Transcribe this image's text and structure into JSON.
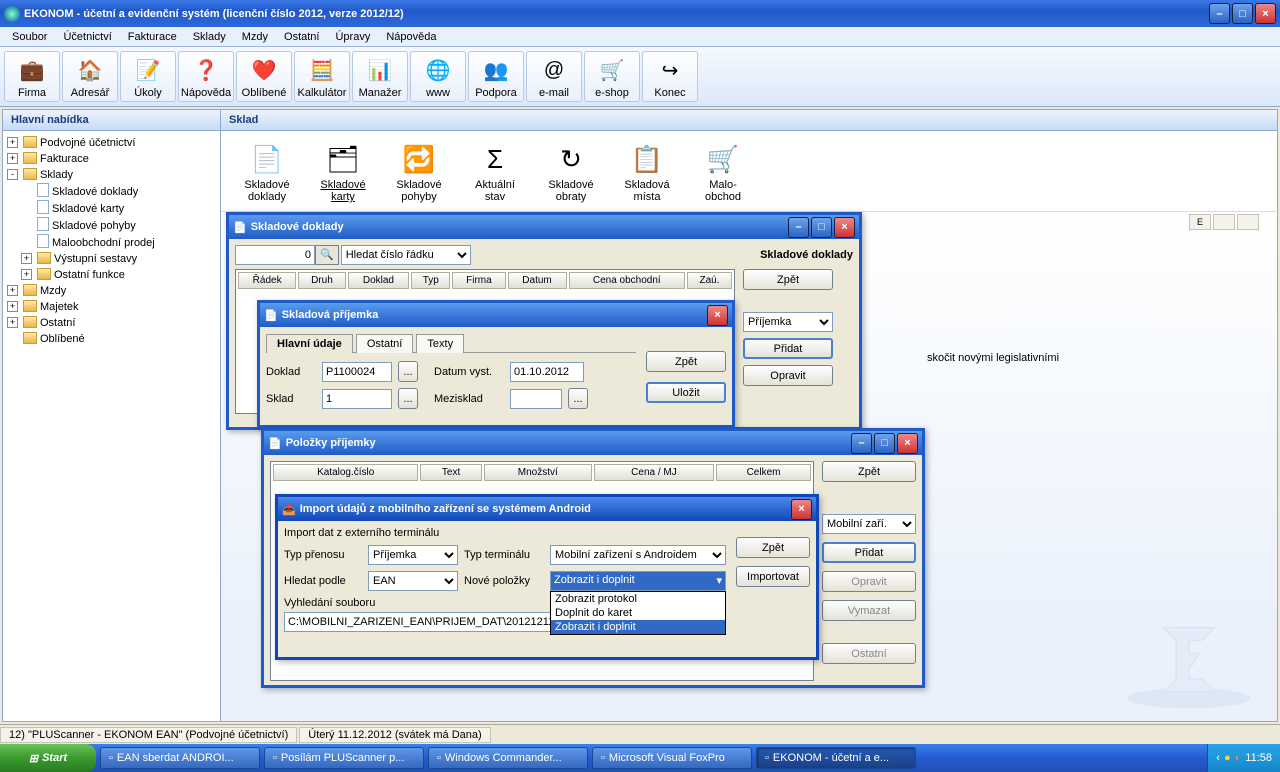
{
  "app": {
    "title": "EKONOM - účetní a evidenční systém (licenční číslo 2012, verze 2012/12)"
  },
  "menu": [
    "Soubor",
    "Účetnictví",
    "Fakturace",
    "Sklady",
    "Mzdy",
    "Ostatní",
    "Úpravy",
    "Nápověda"
  ],
  "toolbar": [
    {
      "label": "Firma",
      "icon": "💼"
    },
    {
      "label": "Adresář",
      "icon": "🏠"
    },
    {
      "label": "Úkoly",
      "icon": "📝"
    },
    {
      "label": "Nápověda",
      "icon": "❓"
    },
    {
      "label": "Oblíbené",
      "icon": "❤️"
    },
    {
      "label": "Kalkulátor",
      "icon": "🧮"
    },
    {
      "label": "Manažer",
      "icon": "📊"
    },
    {
      "label": "www",
      "icon": "🌐"
    },
    {
      "label": "Podpora",
      "icon": "👥"
    },
    {
      "label": "e-mail",
      "icon": "@"
    },
    {
      "label": "e-shop",
      "icon": "🛒"
    },
    {
      "label": "Konec",
      "icon": "↪"
    }
  ],
  "sidebar": {
    "title": "Hlavní nabídka",
    "tree": [
      {
        "t": "Podvojné účetnictví",
        "exp": "+",
        "fld": true
      },
      {
        "t": "Fakturace",
        "exp": "+",
        "fld": true
      },
      {
        "t": "Sklady",
        "exp": "-",
        "fld": true,
        "ch": [
          {
            "t": "Skladové doklady",
            "doc": true
          },
          {
            "t": "Skladové karty",
            "doc": true
          },
          {
            "t": "Skladové pohyby",
            "doc": true
          },
          {
            "t": "Maloobchodní prodej",
            "doc": true
          },
          {
            "t": "Výstupní sestavy",
            "exp": "+",
            "fld": true
          },
          {
            "t": "Ostatní funkce",
            "exp": "+",
            "fld": true
          }
        ]
      },
      {
        "t": "Mzdy",
        "exp": "+",
        "fld": true
      },
      {
        "t": "Majetek",
        "exp": "+",
        "fld": true
      },
      {
        "t": "Ostatní",
        "exp": "+",
        "fld": true
      },
      {
        "t": "Oblíbené",
        "fld": true
      }
    ]
  },
  "main": {
    "title": "Sklad",
    "buttons": [
      {
        "l1": "Skladové",
        "l2": "doklady",
        "icon": "📄"
      },
      {
        "l1": "Skladové",
        "l2": "karty",
        "icon": "🗂",
        "active": true
      },
      {
        "l1": "Skladové",
        "l2": "pohyby",
        "icon": "🔁"
      },
      {
        "l1": "Aktuální",
        "l2": "stav",
        "icon": "Σ"
      },
      {
        "l1": "Skladové",
        "l2": "obraty",
        "icon": "↻"
      },
      {
        "l1": "Skladová",
        "l2": "místa",
        "icon": "📋"
      },
      {
        "l1": "Malo-",
        "l2": "obchod",
        "icon": "🛒"
      }
    ],
    "bg_text": "skočit novými legislativními"
  },
  "stat_panel": [
    "E",
    "",
    ""
  ],
  "win_doklady": {
    "title": "Skladové doklady",
    "headerLabel": "Skladové doklady",
    "searchNum": "0",
    "searchPh": "Hledat číslo řádku",
    "cols": [
      "Řádek",
      "Druh",
      "Doklad",
      "Typ",
      "Firma",
      "Datum",
      "Cena obchodní",
      "Zaú."
    ],
    "btns": {
      "zpet": "Zpět",
      "prijemka": "Příjemka",
      "pridat": "Přidat",
      "opravit": "Opravit"
    }
  },
  "win_prij": {
    "title": "Skladová příjemka",
    "tabs": [
      "Hlavní údaje",
      "Ostatní",
      "Texty"
    ],
    "fields": {
      "doklad_l": "Doklad",
      "doklad_v": "P1100024",
      "sklad_l": "Sklad",
      "sklad_v": "1",
      "datum_l": "Datum vyst.",
      "datum_v": "01.10.2012",
      "mezi_l": "Mezisklad",
      "mezi_v": ""
    },
    "btns": {
      "zpet": "Zpět",
      "ulozit": "Uložit"
    }
  },
  "win_pol": {
    "title": "Položky příjemky",
    "cols": [
      "Katalog.číslo",
      "Text",
      "Množství",
      "Cena / MJ",
      "Celkem"
    ],
    "btns": {
      "zpet": "Zpět",
      "mobil": "Mobilní zaří.",
      "pridat": "Přidat",
      "opravit": "Opravit",
      "vymazat": "Vymazat",
      "ostatni": "Ostatní"
    }
  },
  "win_imp": {
    "title": "Import údajů z mobilního zařízení se systémem Android",
    "l_import": "Import dat z externího terminálu",
    "l_typ": "Typ přenosu",
    "v_typ": "Příjemka",
    "l_term": "Typ terminálu",
    "v_term": "Mobilní zařízení s Androidem",
    "l_hledat": "Hledat podle",
    "v_hledat": "EAN",
    "l_nove": "Nové položky",
    "v_nove": "Zobrazit i doplnit",
    "dd": [
      "Zobrazit protokol",
      "Doplnit do karet",
      "Zobrazit i doplnit"
    ],
    "l_vyhl": "Vyhledání souboru",
    "v_vyhl": "C:\\MOBILNI_ZARIZENI_EAN\\PRIJEM_DAT\\20121211...",
    "btns": {
      "zpet": "Zpět",
      "import": "Importovat"
    }
  },
  "status": {
    "left": "12) \"PLUScanner - EKONOM EAN\"  (Podvojné účetnictví)",
    "right": "Úterý 11.12.2012 (svátek má Dana)"
  },
  "taskbar": {
    "start": "Start",
    "tasks": [
      {
        "t": "EAN sberdat ANDROI...",
        "a": false
      },
      {
        "t": "Posílám PLUScanner p...",
        "a": false
      },
      {
        "t": "Windows Commander...",
        "a": false
      },
      {
        "t": "Microsoft Visual FoxPro",
        "a": false
      },
      {
        "t": "EKONOM - účetní a e...",
        "a": true
      }
    ],
    "clock": "11:58"
  }
}
